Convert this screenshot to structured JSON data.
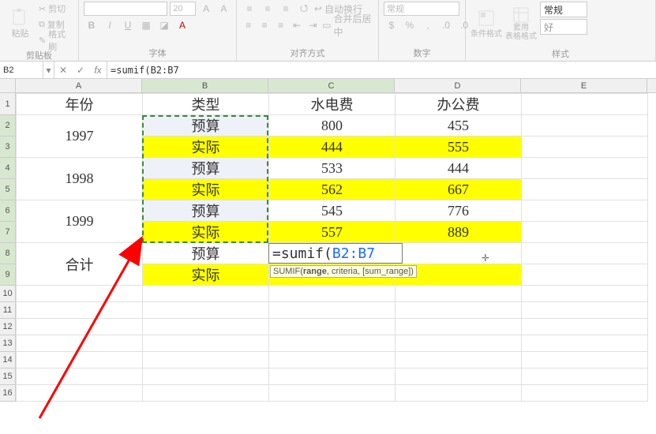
{
  "ribbon": {
    "clipboard": {
      "paste": "粘贴",
      "cut": "剪切",
      "copy": "复制",
      "format_painter": "格式刷",
      "label": "剪贴板"
    },
    "font": {
      "name": "",
      "size": "20",
      "label": "字体",
      "bold": "B",
      "italic": "I",
      "underline": "U"
    },
    "alignment": {
      "wrap": "自动换行",
      "merge": "合并后居中",
      "label": "对齐方式"
    },
    "number": {
      "format": "常规",
      "label": "数字"
    },
    "styles": {
      "cond_format": "条件格式",
      "table_format": "套用\n表格格式",
      "normal": "常规",
      "good": "好",
      "label": "样式"
    }
  },
  "name_box": "B2",
  "formula_text_prefix": "=sumif(",
  "formula_text_ref": "B2:B7",
  "col_headers": [
    "A",
    "B",
    "C",
    "D",
    "E"
  ],
  "row_headers": [
    "1",
    "2",
    "3",
    "4",
    "5",
    "6",
    "7",
    "8",
    "9",
    "10",
    "11",
    "12",
    "13",
    "14",
    "15",
    "16"
  ],
  "grid": {
    "r1": {
      "A": "年份",
      "B": "类型",
      "C": "水电费",
      "D": "办公费"
    },
    "r2": {
      "A": "1997",
      "B": "预算",
      "C": "800",
      "D": "455"
    },
    "r3": {
      "B": "实际",
      "C": "444",
      "D": "555"
    },
    "r4": {
      "A": "1998",
      "B": "预算",
      "C": "533",
      "D": "444"
    },
    "r5": {
      "B": "实际",
      "C": "562",
      "D": "667"
    },
    "r6": {
      "A": "1999",
      "B": "预算",
      "C": "545",
      "D": "776"
    },
    "r7": {
      "B": "实际",
      "C": "557",
      "D": "889"
    },
    "r8": {
      "A": "合计",
      "B": "预算"
    },
    "r9": {
      "B": "实际"
    }
  },
  "editing": {
    "text_prefix": "=sumif(",
    "text_ref": "B2:B7"
  },
  "tooltip": {
    "func": "SUMIF",
    "sig": "(range, criteria, [sum_range])",
    "bold_arg": "range"
  }
}
